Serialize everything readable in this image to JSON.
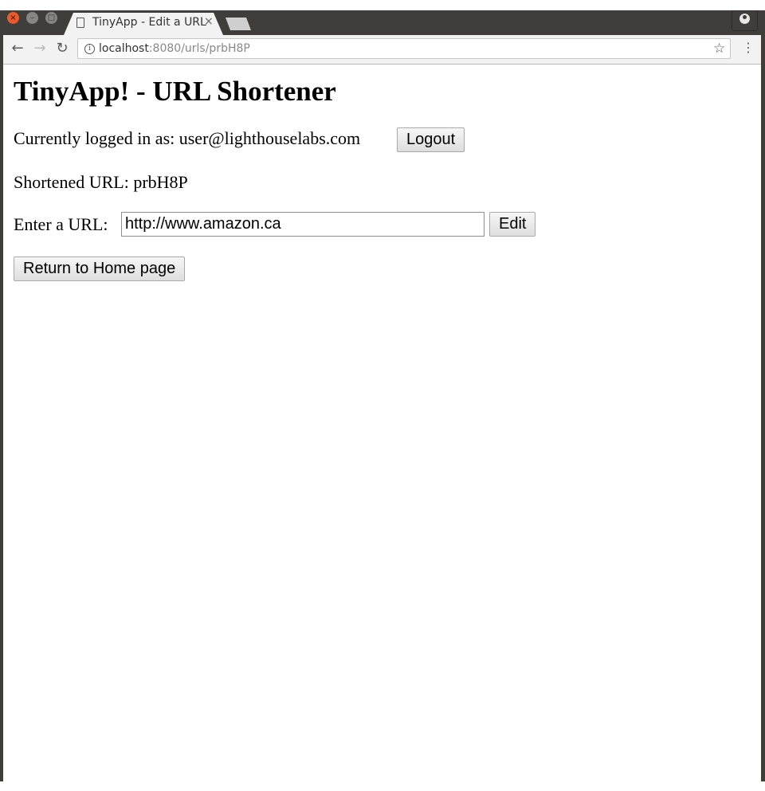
{
  "browser": {
    "tab_title": "TinyApp - Edit a URL",
    "tab_close": "×",
    "url_host": "localhost",
    "url_rest": ":8080/urls/prbH8P",
    "info_glyph": "i",
    "star_glyph": "☆",
    "menu_glyph": "⋮",
    "back_glyph": "←",
    "forward_glyph": "→",
    "reload_glyph": "↻",
    "close_glyph": "×",
    "minimize_glyph": "–",
    "maximize_glyph": "□"
  },
  "page": {
    "heading": "TinyApp! - URL Shortener",
    "login_text": "Currently logged in as: user@lighthouselabs.com",
    "logout_label": "Logout",
    "shortened_text": "Shortened URL: prbH8P",
    "enter_url_label": "Enter a URL:",
    "url_value": "http://www.amazon.ca",
    "edit_label": "Edit",
    "home_label": "Return to Home page"
  },
  "colors": {
    "titlebar": "#3f3e3b",
    "close_button": "#ea5a2d",
    "toolbar": "#f2f2f2"
  }
}
